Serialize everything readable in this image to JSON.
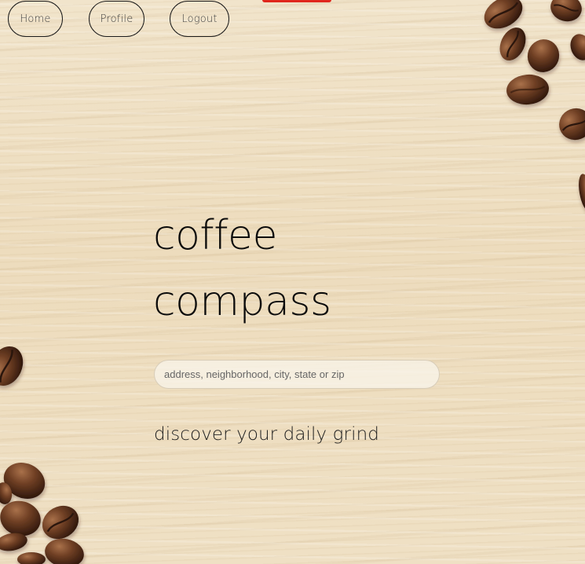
{
  "nav": {
    "home_label": "Home",
    "profile_label": "Profile",
    "logout_label": "Logout"
  },
  "hero": {
    "title_line1": "coffee",
    "title_line2": "compass",
    "tagline": "discover your daily grind"
  },
  "search": {
    "placeholder": "address, neighborhood, city, state or zip",
    "value": ""
  },
  "colors": {
    "accent_tab": "#e0261d",
    "background_wood": "#efe0c4",
    "bean_brown": "#6b3e24"
  }
}
